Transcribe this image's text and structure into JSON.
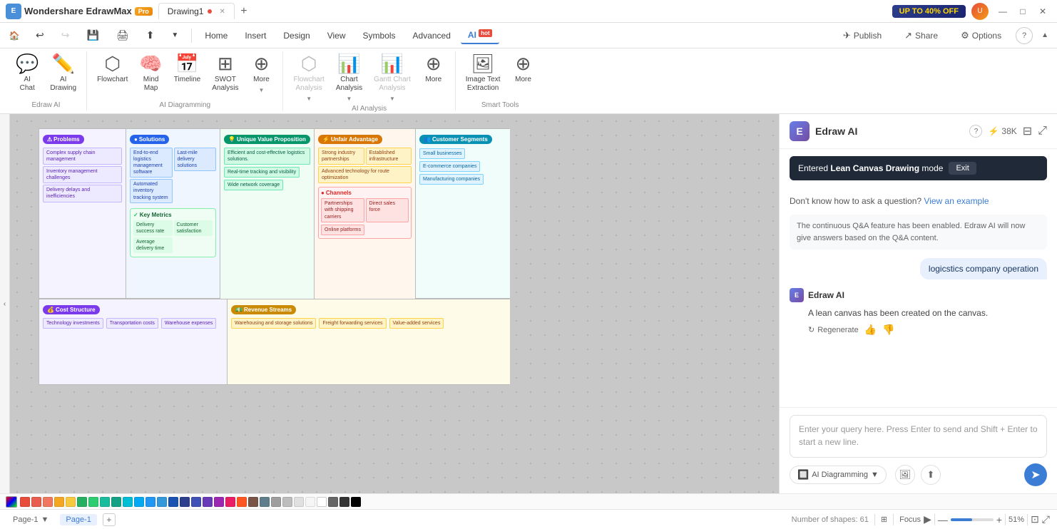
{
  "titlebar": {
    "app_name": "Wondershare EdrawMax",
    "pro_label": "Pro",
    "drawing_tab": "Drawing1",
    "promo_text": "UP TO 40% OFF",
    "window_minimize": "—",
    "window_maximize": "□",
    "window_close": "✕"
  },
  "menubar": {
    "items": [
      "Home",
      "Insert",
      "Design",
      "View",
      "Symbols",
      "Advanced",
      "AI"
    ],
    "ai_hot_badge": "hot",
    "right": {
      "publish": "Publish",
      "share": "Share",
      "options": "Options"
    }
  },
  "ribbon": {
    "edraw_ai": {
      "label": "Edraw AI",
      "items": [
        {
          "id": "ai-chat",
          "icon": "💬",
          "label": "AI\nChat"
        },
        {
          "id": "ai-drawing",
          "icon": "✏️",
          "label": "AI\nDrawing"
        }
      ]
    },
    "ai_diagramming": {
      "label": "AI Diagramming",
      "items": [
        {
          "id": "flowchart",
          "icon": "⬡",
          "label": "Flowchart"
        },
        {
          "id": "mindmap",
          "icon": "🧠",
          "label": "Mind\nMap"
        },
        {
          "id": "timeline",
          "icon": "📅",
          "label": "Timeline"
        },
        {
          "id": "swot",
          "icon": "⊞",
          "label": "SWOT\nAnalysis"
        },
        {
          "id": "more-diag",
          "icon": "⊕",
          "label": "More",
          "dropdown": true
        }
      ]
    },
    "ai_analysis": {
      "label": "AI Analysis",
      "items": [
        {
          "id": "flowchart-analysis",
          "icon": "⬡",
          "label": "Flowchart\nAnalysis",
          "disabled": true,
          "dropdown": true
        },
        {
          "id": "chart-analysis",
          "icon": "📊",
          "label": "Chart\nAnalysis",
          "dropdown": true
        },
        {
          "id": "gantt",
          "icon": "📊",
          "label": "Gantt Chart\nAnalysis",
          "disabled": true,
          "dropdown": true
        },
        {
          "id": "more-analysis",
          "icon": "⊕",
          "label": "More"
        }
      ]
    },
    "smart_tools": {
      "label": "Smart Tools",
      "items": [
        {
          "id": "image-text",
          "icon": "🖼",
          "label": "Image Text\nExtraction"
        },
        {
          "id": "more-tools",
          "icon": "⊕",
          "label": "More"
        }
      ]
    }
  },
  "lean_canvas": {
    "sections": {
      "problems": {
        "title": "Problems",
        "color": "purple",
        "icon": "⚠",
        "chips": [
          "Complex supply chain management",
          "Inventory management challenges",
          "Delivery delays and inefficiencies"
        ]
      },
      "solutions": {
        "title": "Solutions",
        "color": "blue",
        "icon": "🔵",
        "chips_left": [
          "End-to-end logistics management software",
          "Automated inventory tracking system"
        ],
        "chips_right": [
          "Last-mile delivery solutions"
        ],
        "key_metrics": {
          "title": "Key Metrics",
          "chips": [
            "Delivery success rate",
            "Average delivery time",
            "Customer satisfaction"
          ]
        }
      },
      "unique_value": {
        "title": "Unique Value Proposition",
        "color": "green",
        "icon": "💡",
        "chips": [
          "Efficient and cost-effective logistics solutions.",
          "Real-time tracking and visibility",
          "Wide network coverage"
        ]
      },
      "unfair_advantage": {
        "title": "Unfair Advantage",
        "color": "orange",
        "icon": "⚡",
        "chips_top": [
          "Strong industry partnerships",
          "Established infrastructure",
          "Advanced technology for route optimization"
        ],
        "channels": {
          "title": "Channels",
          "chips": [
            "Partnerships with shipping carriers",
            "Direct sales force",
            "Online platforms"
          ]
        }
      },
      "customer_segments": {
        "title": "Customer Segments",
        "color": "teal",
        "icon": "👥",
        "chips": [
          "Small businesses",
          "E-commerce companies",
          "Manufacturing companies"
        ]
      },
      "cost_structure": {
        "title": "Cost Structure",
        "color": "purple",
        "icon": "💰",
        "chips": [
          "Technology investments",
          "Transportation costs",
          "Warehouse expenses"
        ]
      },
      "revenue_streams": {
        "title": "Revenue Streams",
        "color": "yellow",
        "icon": "💵",
        "chips": [
          "Warehousing and storage solutions",
          "Freight forwarding services",
          "Value-added services"
        ]
      }
    }
  },
  "ai_panel": {
    "title": "Edraw AI",
    "help_icon": "?",
    "token_count": "38K",
    "mode_tooltip": {
      "text": "Entered",
      "mode": "Lean Canvas Drawing",
      "suffix": "mode",
      "exit_btn": "Exit"
    },
    "messages": [
      {
        "type": "system",
        "text": "Don't know how to ask a question?",
        "link": "View an example"
      },
      {
        "type": "info",
        "text": "The continuous Q&A feature has been enabled. Edraw AI will now give answers based on the Q&A content."
      },
      {
        "type": "user",
        "text": "logicstics company operation"
      },
      {
        "type": "ai",
        "name": "Edraw AI",
        "text": "A lean canvas has been created on the canvas.",
        "actions": {
          "regenerate": "Regenerate",
          "like": "👍",
          "dislike": "👎"
        }
      }
    ],
    "input": {
      "placeholder": "Enter your query here. Press Enter to send and Shift + Enter to start a new line.",
      "mode_select": "AI Diagramming",
      "send_icon": "➤"
    }
  },
  "bottom_bar": {
    "page1_menu": "Page-1",
    "page1_tab": "Page-1",
    "add_page_icon": "+",
    "shape_count_label": "Number of shapes: 61",
    "zoom_percent": "51%",
    "focus_label": "Focus"
  },
  "color_palette": [
    "#e74c3c",
    "#e67e22",
    "#f1c40f",
    "#2ecc71",
    "#1abc9c",
    "#3498db",
    "#9b59b6",
    "#e91e63",
    "#ff5722",
    "#ff9800",
    "#ffc107",
    "#cddc39",
    "#8bc34a",
    "#4caf50",
    "#009688",
    "#00bcd4",
    "#03a9f4",
    "#2196f3",
    "#3f51b5",
    "#673ab7",
    "#9c27b0",
    "#e91e63",
    "#f44336",
    "#795548",
    "#607d8b",
    "#9e9e9e",
    "#ffffff",
    "#000000"
  ]
}
